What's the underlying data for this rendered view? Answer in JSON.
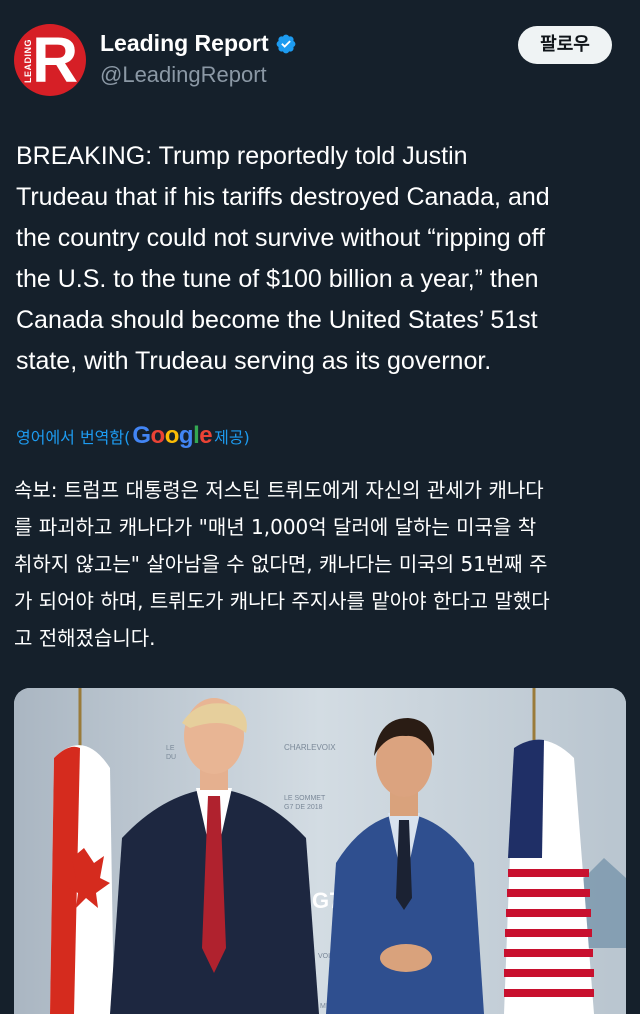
{
  "account": {
    "name": "Leading Report",
    "handle": "@LeadingReport",
    "avatar_letter": "R",
    "avatar_vertical_text": "LEADING",
    "verified_icon": "verified-badge-icon"
  },
  "follow_button": {
    "label": "팔로우"
  },
  "tweet": {
    "lines": [
      "BREAKING: Trump reportedly told Justin",
      "Trudeau that if his tariffs destroyed Canada, and",
      "the country could not survive without “ripping off",
      "the U.S. to the tune of $100 billion a year,” then",
      "Canada should become the United States’ 51st",
      "state, with Trudeau serving as its governor."
    ]
  },
  "translation": {
    "prefix": "영어에서 번역함(",
    "provider": "Google",
    "suffix": " 제공)",
    "lines": [
      "속보: 트럼프 대통령은 저스틴 트뤼도에게 자신의 관세가 캐나다",
      "를 파괴하고 캐나다가 \"매년 1,000억 달러에 달하는 미국을 착",
      "취하지 않고는\" 살아남을 수 없다면, 캐나다는 미국의 51번째 주",
      "가 되어야 하며, 트뤼도가 캐나다 주지사를 맡아야 한다고 말했다",
      "고 전해졌습니다."
    ]
  },
  "media": {
    "backdrop_texts": [
      "CHARLEVOIX",
      "LE SOMMET",
      "G7 DE 2018",
      "G7",
      "VOIX",
      "LE",
      "DU",
      "MET"
    ],
    "colors": {
      "flag_red": "#d52b1e",
      "suit_navy": "#1d2740",
      "suit_blue": "#2f4f8f",
      "backdrop": "#c9d3db"
    }
  },
  "colors": {
    "background": "#15202b",
    "text": "#ffffff",
    "secondary": "#8b98a5",
    "link": "#1d9bf0",
    "avatar_red": "#d61f26"
  }
}
